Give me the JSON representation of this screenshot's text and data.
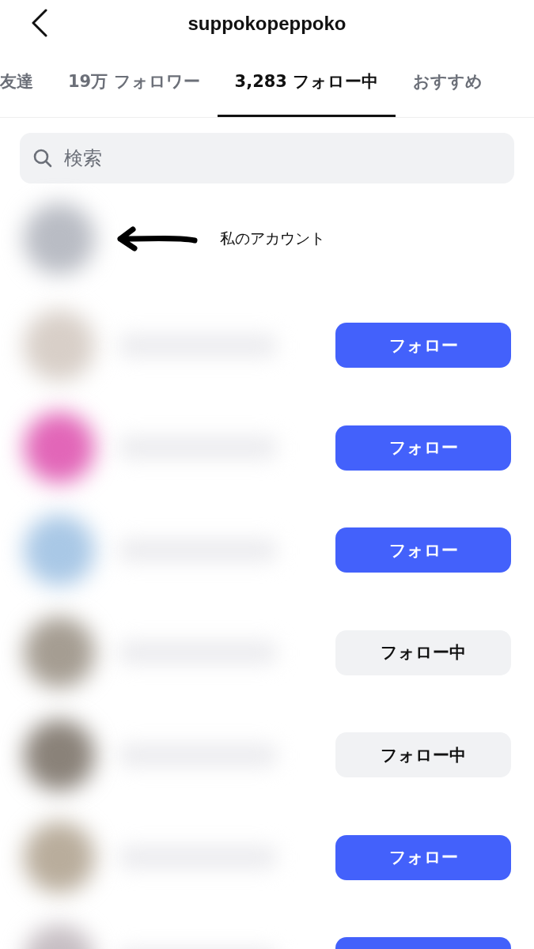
{
  "header": {
    "title": "suppokopeppoko"
  },
  "tabs": [
    {
      "label": "友達",
      "selected": false
    },
    {
      "label": "19万 フォロワー",
      "selected": false
    },
    {
      "label": "3,283 フォロー中",
      "selected": true
    },
    {
      "label": "おすすめ",
      "selected": false
    }
  ],
  "search": {
    "placeholder": "検索"
  },
  "my_account": {
    "color": "#b9bcc4",
    "annotation": "私のアカウント"
  },
  "rows": [
    {
      "color": "#d8cfc8",
      "following": false,
      "button": "フォロー"
    },
    {
      "color": "#e266b8",
      "following": false,
      "button": "フォロー"
    },
    {
      "color": "#a9c8e6",
      "following": false,
      "button": "フォロー"
    },
    {
      "color": "#a59d92",
      "following": true,
      "button": "フォロー中"
    },
    {
      "color": "#8a8279",
      "following": true,
      "button": "フォロー中"
    },
    {
      "color": "#b9ad9c",
      "following": false,
      "button": "フォロー"
    },
    {
      "color": "#c7bfc4",
      "following": false
    }
  ]
}
